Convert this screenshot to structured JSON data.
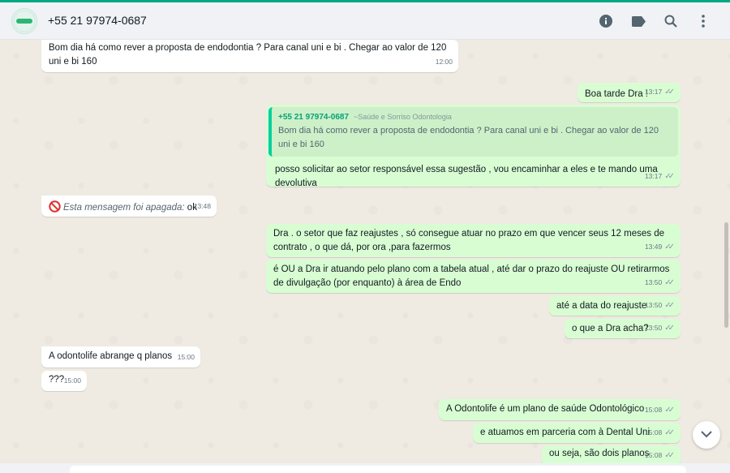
{
  "header": {
    "contact_name": "+55 21 97974-0687",
    "icons": [
      "info-icon",
      "label-icon",
      "search-icon",
      "menu-icon"
    ]
  },
  "colors": {
    "accent": "#00a884",
    "incoming": "#ffffff",
    "outgoing": "#d9fdd3",
    "quote_author": "#06a17a"
  },
  "messages": [
    {
      "text": "Bom dia há como rever a proposta de endodontia ? Para canal uni e bi .  Chegar ao valor de 120 uni e bi 160",
      "time": "12:00"
    },
    {
      "text": "Boa tarde Dra !",
      "time": "13:17"
    },
    {
      "quote_author": "+55 21 97974-0687",
      "quote_subtitle": "~Saúde e Sorriso Odontologia",
      "quote_text": "Bom dia há como rever a proposta de endodontia ? Para canal uni e bi .  Chegar ao valor de 120 uni e bi 160",
      "text": "posso solicitar ao setor responsável essa sugestão , vou encaminhar a eles e te mando uma devolutiva",
      "time": "13:17"
    },
    {
      "deleted_text": "Esta mensagem foi apagada:",
      "text": " ok",
      "time": "13:48"
    },
    {
      "text": "Dra . o setor que faz reajustes , só consegue atuar no prazo em que vencer seus 12 meses de contrato , o que dá, por ora ,para fazermos",
      "time": "13:49"
    },
    {
      "text": "é OU a Dra ir atuando pelo plano com a tabela atual , até dar o prazo do reajuste  OU retirarmos de divulgação (por enquanto) à área de Endo",
      "time": "13:50"
    },
    {
      "text": "até a data do reajuste",
      "time": "13:50"
    },
    {
      "text": "o que a Dra acha?",
      "time": "13:50"
    },
    {
      "text": "A odontolife  abrange q planos",
      "time": "15:00"
    },
    {
      "text": "???",
      "time": "15:00"
    },
    {
      "text": "A Odontolife é um plano de saúde Odontológico",
      "time": "15:08"
    },
    {
      "text": "e atuamos em parceria com à Dental Uni",
      "time": "15:08"
    },
    {
      "text": "ou seja, são dois planos",
      "time": "15:08"
    }
  ]
}
